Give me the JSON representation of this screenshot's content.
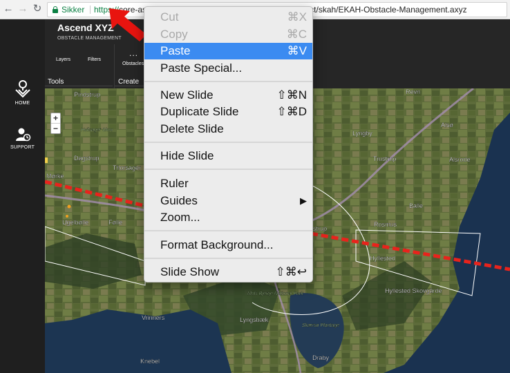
{
  "browser": {
    "back_icon": "back-arrow-icon",
    "forward_icon": "forward-arrow-icon",
    "reload_icon": "reload-icon",
    "secure_label": "Sikker",
    "url_scheme": "https://",
    "url_rest": "core-asy…77……h…4.azurewebsites.net/…/#/project/skah/EKAH-Obstacle-Management.axyz"
  },
  "sidebar": {
    "home_label": "HOME",
    "support_label": "SUPPORT"
  },
  "app": {
    "title": "Ascend XYZ",
    "subtitle": "OBSTACLE MANAGEMENT",
    "tools": {
      "layers_label": "Layers",
      "filters_label": "Filters",
      "obstacles_label": "Obstacles",
      "more_label": "..."
    },
    "groups": {
      "tools_label": "Tools",
      "create_label": "Create"
    }
  },
  "map": {
    "zoom_in": "+",
    "zoom_out": "−",
    "places": [
      "Pindstrup",
      "Hvilsager Skov",
      "Dagstrup",
      "Thorsager",
      "Mørke",
      "Ugelbølle",
      "Følle",
      "Revn",
      "Lyngby",
      "Alsø",
      "Trustrup",
      "Alsrode",
      "Balle",
      "Rosmus",
      "Hyllested",
      "Hyllested Skovgårde",
      "Mols Bjerge National Park",
      "Vrinners",
      "Lyngsbæk",
      "Skærsø Plantage",
      "Knebel",
      "Draby",
      "strup"
    ]
  },
  "context_menu": {
    "items": [
      {
        "label": "Cut",
        "shortcut": "⌘X",
        "state": "disabled"
      },
      {
        "label": "Copy",
        "shortcut": "⌘C",
        "state": "disabled"
      },
      {
        "label": "Paste",
        "shortcut": "⌘V",
        "state": "selected"
      },
      {
        "label": "Paste Special...",
        "shortcut": "",
        "state": "normal"
      },
      {
        "label": "New Slide",
        "shortcut": "⇧⌘N",
        "state": "normal"
      },
      {
        "label": "Duplicate Slide",
        "shortcut": "⇧⌘D",
        "state": "normal"
      },
      {
        "label": "Delete Slide",
        "shortcut": "",
        "state": "normal"
      },
      {
        "label": "Hide Slide",
        "shortcut": "",
        "state": "normal"
      },
      {
        "label": "Ruler",
        "shortcut": "",
        "state": "normal"
      },
      {
        "label": "Guides",
        "shortcut": "▶",
        "state": "normal"
      },
      {
        "label": "Zoom...",
        "shortcut": "",
        "state": "normal"
      },
      {
        "label": "Format Background...",
        "shortcut": "",
        "state": "normal"
      },
      {
        "label": "Slide Show",
        "shortcut": "⇧⌘↩",
        "state": "normal"
      }
    ]
  },
  "colors": {
    "selection": "#3b8bf1",
    "secure_green": "#0b8043",
    "annotation_red": "#e8140f",
    "obstacle_line_red": "#e8231c"
  }
}
